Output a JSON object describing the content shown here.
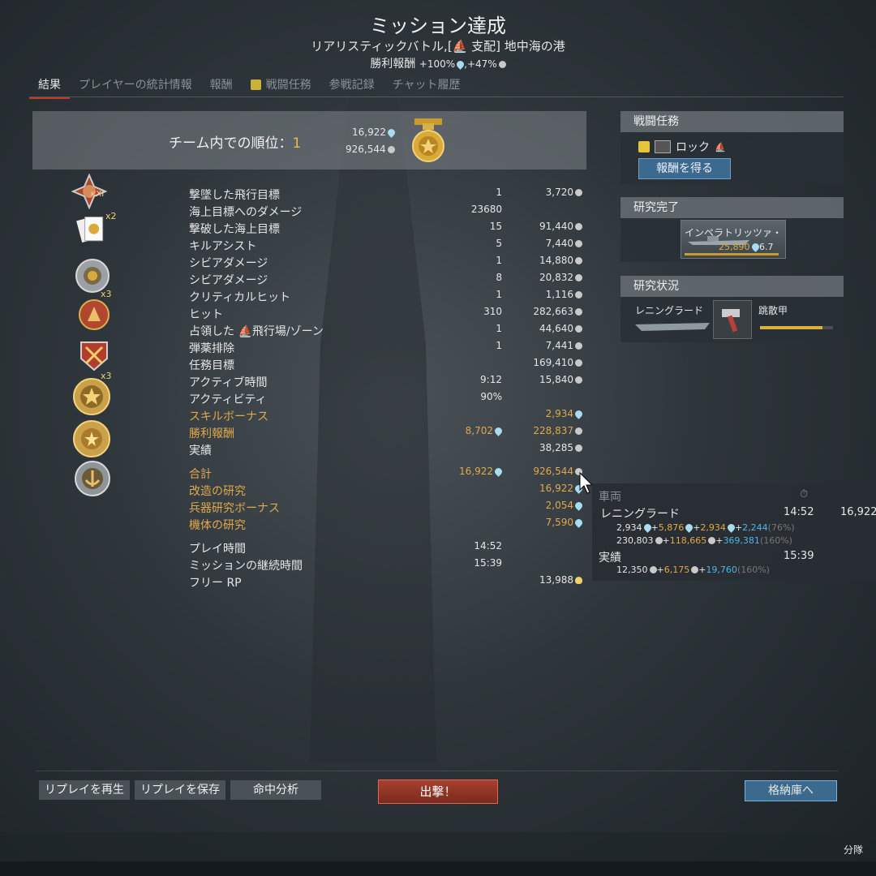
{
  "header": {
    "title": "ミッション達成",
    "subtitle": "リアリスティックバトル,[⛵ 支配] 地中海の港",
    "reward_label": "勝利報酬",
    "reward_value": "+100%",
    "reward_value2": ",+47%"
  },
  "tabs": [
    {
      "label": "結果",
      "active": true
    },
    {
      "label": "プレイヤーの統計情報"
    },
    {
      "label": "報酬"
    },
    {
      "label": "戦闘任務",
      "checked": true
    },
    {
      "label": "参戦記録"
    },
    {
      "label": "チャット履歴"
    }
  ],
  "rank": {
    "label": "チーム内での順位：",
    "value": "1",
    "rp": "16,922",
    "sl": "926,544"
  },
  "stats": [
    {
      "label": "撃墜した飛行目標",
      "a": "1",
      "b": "3,720",
      "b_cur": "sl"
    },
    {
      "label": "海上目標へのダメージ",
      "a": "23680",
      "b": ""
    },
    {
      "label": "撃破した海上目標",
      "a": "15",
      "b": "91,440",
      "b_cur": "sl"
    },
    {
      "label": "キルアシスト",
      "a": "5",
      "b": "7,440",
      "b_cur": "sl"
    },
    {
      "label": "シビアダメージ",
      "a": "1",
      "b": "14,880",
      "b_cur": "sl"
    },
    {
      "label": "シビアダメージ",
      "a": "8",
      "b": "20,832",
      "b_cur": "sl"
    },
    {
      "label": "クリティカルヒット",
      "a": "1",
      "b": "1,116",
      "b_cur": "sl"
    },
    {
      "label": "ヒット",
      "a": "310",
      "b": "282,663",
      "b_cur": "sl"
    },
    {
      "label": "占領した ⛵飛行場/ゾーン",
      "a": "1",
      "b": "44,640",
      "b_cur": "sl"
    },
    {
      "label": "弾薬排除",
      "a": "1",
      "b": "7,441",
      "b_cur": "sl"
    },
    {
      "label": "任務目標",
      "a": "",
      "b": "169,410",
      "b_cur": "sl"
    },
    {
      "label": "アクティブ時間",
      "a": "9:12",
      "b": "15,840",
      "b_cur": "sl"
    },
    {
      "label": "アクティビティ",
      "a": "90%",
      "b": ""
    },
    {
      "label": "スキルボーナス",
      "a": "",
      "b": "2,934",
      "b_cur": "rp",
      "gold": true
    },
    {
      "label": "勝利報酬",
      "a": "8,702",
      "a_cur": "rp",
      "b": "228,837",
      "b_cur": "sl",
      "gold": true
    },
    {
      "label": "実績",
      "a": "",
      "b": "38,285",
      "b_cur": "sl"
    },
    {
      "label": "合計",
      "a": "16,922",
      "a_cur": "rp",
      "b": "926,544",
      "b_cur": "sl",
      "gold": true,
      "gap": true
    },
    {
      "label": "改造の研究",
      "a": "",
      "b": "16,922",
      "b_cur": "rp",
      "gold": true
    },
    {
      "label": "兵器研究ボーナス",
      "a": "",
      "b": "2,054",
      "b_cur": "rp",
      "gold": true
    },
    {
      "label": "機体の研究",
      "a": "",
      "b": "7,590",
      "b_cur": "rp",
      "gold": true
    },
    {
      "label": "プレイ時間",
      "a": "14:52",
      "b": "",
      "gap": true
    },
    {
      "label": "ミッションの継続時間",
      "a": "15:39",
      "b": ""
    },
    {
      "label": "フリー RP",
      "a": "",
      "b": "13,988",
      "b_cur": "bulb"
    }
  ],
  "award_badges": [
    "x2",
    "x3",
    "x3"
  ],
  "award_badge_top": "×XI",
  "missions_panel": {
    "title": "戦闘任務",
    "mission_name": "ロック",
    "button": "報酬を得る"
  },
  "research_done_panel": {
    "title": "研究完了",
    "vehicle_name": "インペラトリッツァ・",
    "rp": "25,890",
    "br": "6.7"
  },
  "research_status_panel": {
    "title": "研究状況",
    "vehicle": "レニングラード",
    "module": "跳散甲",
    "progress": 0.85
  },
  "tooltip": {
    "header": "車両",
    "vehicle": "レニングラード",
    "time": "14:52",
    "rp_total": "16,922",
    "line1_a": "2,934",
    "line1_b": "5,876",
    "line1_c": "2,934",
    "line1_d": "2,244",
    "line1_pct": "(76%)",
    "line2_a": "230,803",
    "line2_b": "118,665",
    "line2_c": "369,381",
    "line2_pct": "(160%)",
    "achv_label": "実績",
    "achv_time": "15:39",
    "line3_a": "12,350",
    "line3_b": "6,175",
    "line3_c": "19,760",
    "line3_pct": "(160%)"
  },
  "bottom": {
    "replay_play": "リプレイを再生",
    "replay_save": "リプレイを保存",
    "hit_analysis": "命中分析",
    "sortie": "出撃！",
    "hangar": "格納庫へ",
    "squad": "分隊"
  },
  "colors": {
    "accent_gold": "#e0a94a",
    "button_blue": "#3b6a8e",
    "sortie_red": "#a8402e",
    "rp_blue": "#a9dcf0"
  }
}
